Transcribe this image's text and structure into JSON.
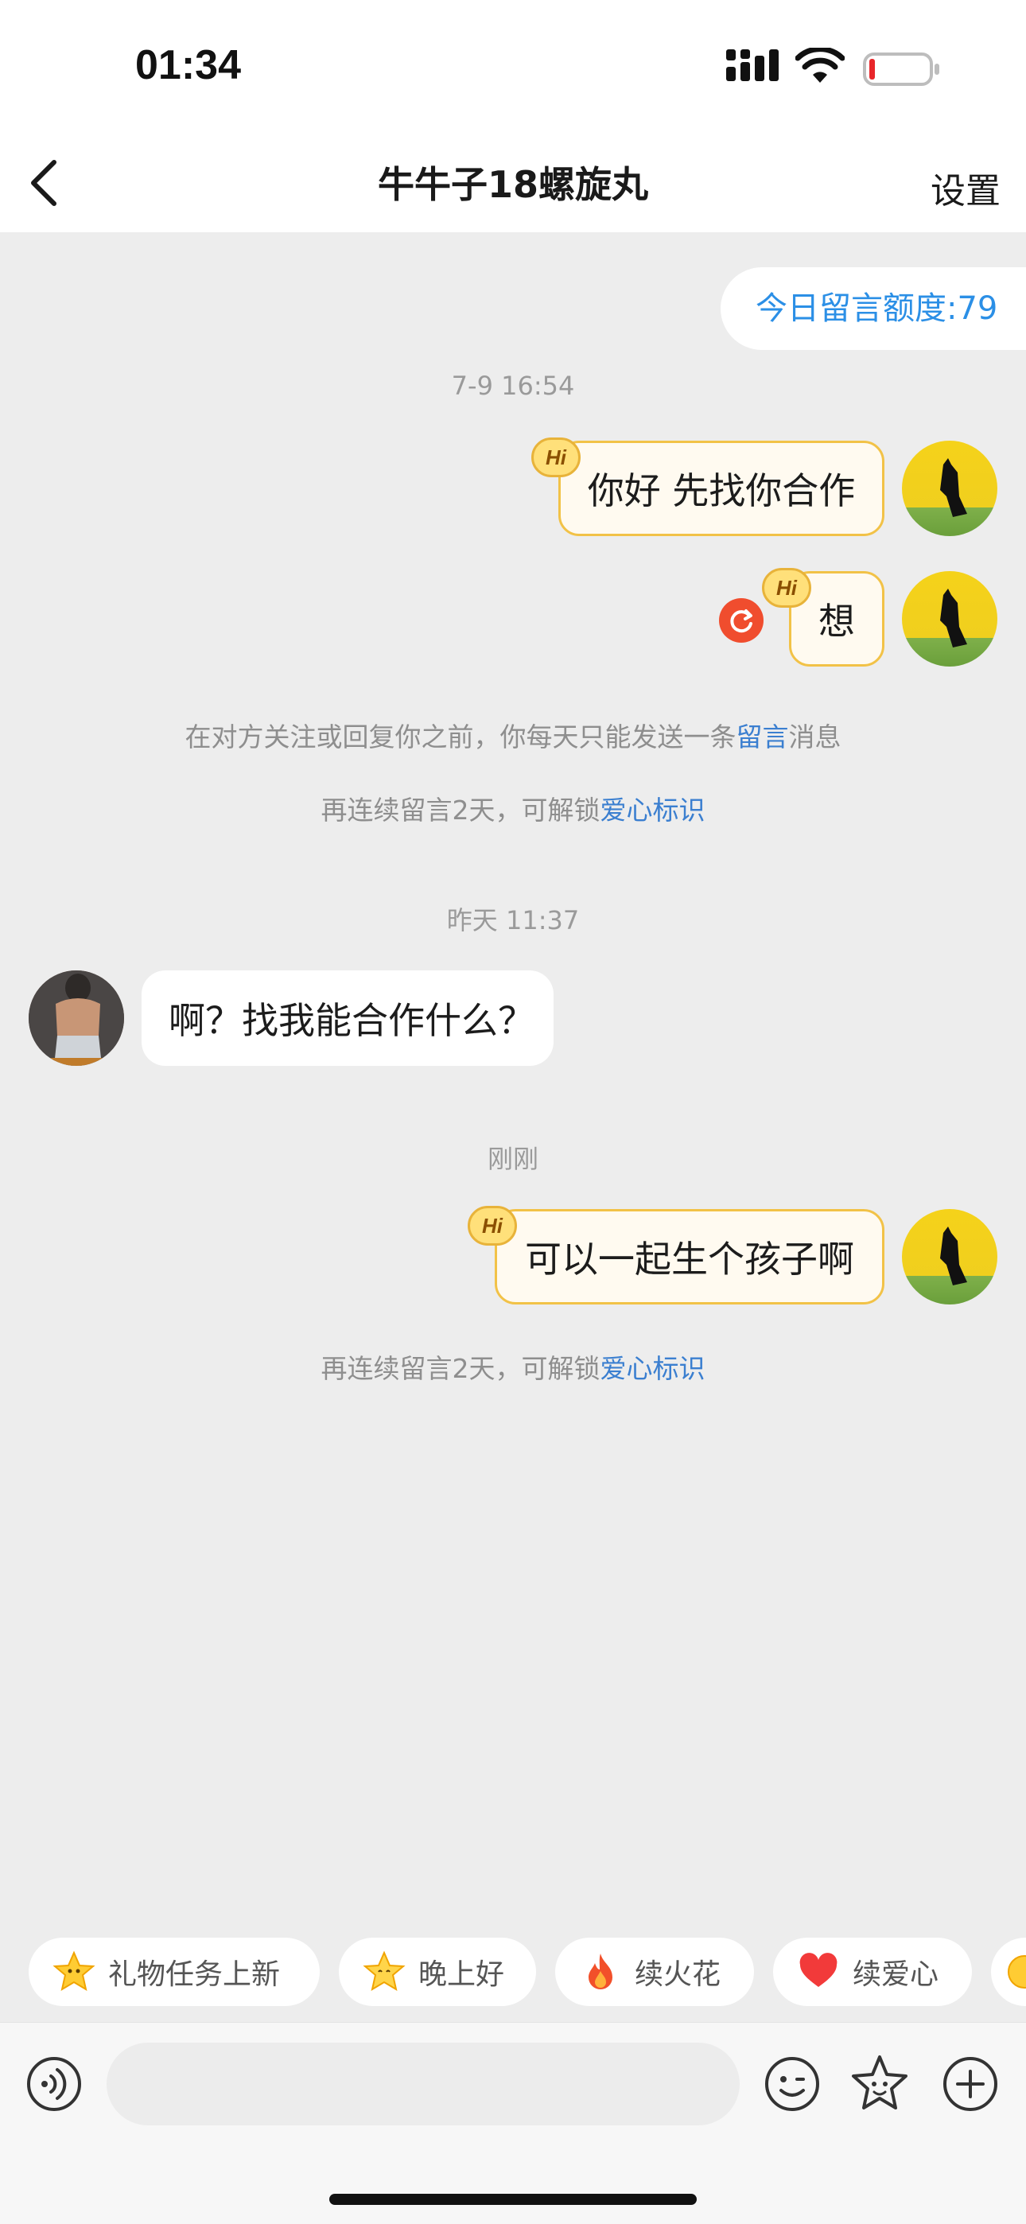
{
  "status_bar": {
    "time": "01:34"
  },
  "nav": {
    "title": "牛牛子18螺旋丸",
    "settings_label": "设置"
  },
  "quota": {
    "text": "今日留言额度:79"
  },
  "messages": {
    "t1": "7-9 16:54",
    "m1": "你好 先找你合作",
    "m2": "想",
    "note1_pre": "在对方关注或回复你之前，你每天只能发送一条",
    "note1_link": "留言",
    "note1_post": "消息",
    "note2_pre": "再连续留言2天，可解锁",
    "note2_link": "爱心标识",
    "t2": "昨天 11:37",
    "m3": "啊？找我能合作什么？",
    "t3": "刚刚",
    "m4": "可以一起生个孩子啊",
    "note3_pre": "再连续留言2天，可解锁",
    "note3_link": "爱心标识",
    "hi_badge": "Hi"
  },
  "chips": [
    {
      "label": "礼物任务上新",
      "icon": "star-face-icon"
    },
    {
      "label": "晚上好",
      "icon": "star-face-icon"
    },
    {
      "label": "续火花",
      "icon": "fire-icon"
    },
    {
      "label": "续爱心",
      "icon": "heart-icon"
    }
  ],
  "colors": {
    "accent_blue": "#2b8fe6",
    "link_blue": "#3b7fd0",
    "hi_border": "#f2c247",
    "background": "#ededed"
  }
}
